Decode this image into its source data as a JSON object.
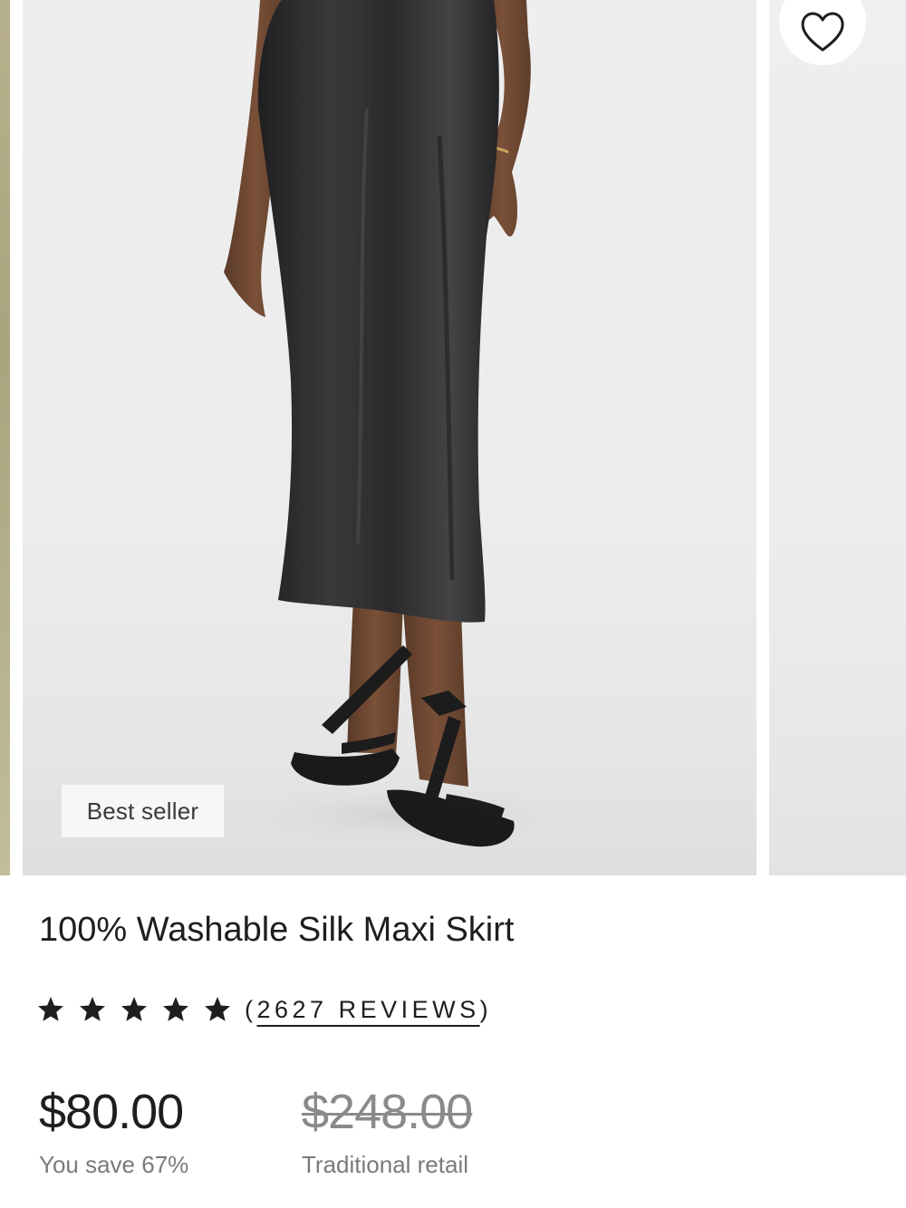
{
  "carousel": {
    "badge": "Best seller",
    "wishlist_icon": "heart-outline-icon"
  },
  "product": {
    "title": "100% Washable Silk Maxi Skirt",
    "rating": 5,
    "rating_max": 5,
    "reviews_open": "(",
    "reviews_text": "2627 REVIEWS",
    "reviews_close": ")",
    "price": "$80.00",
    "savings": "You save 67%",
    "original_price": "$248.00",
    "original_price_label": "Traditional retail"
  },
  "colors": {
    "text": "#1e1e1e",
    "muted": "#7a7a7a",
    "skirt": "#2b2b2d"
  }
}
